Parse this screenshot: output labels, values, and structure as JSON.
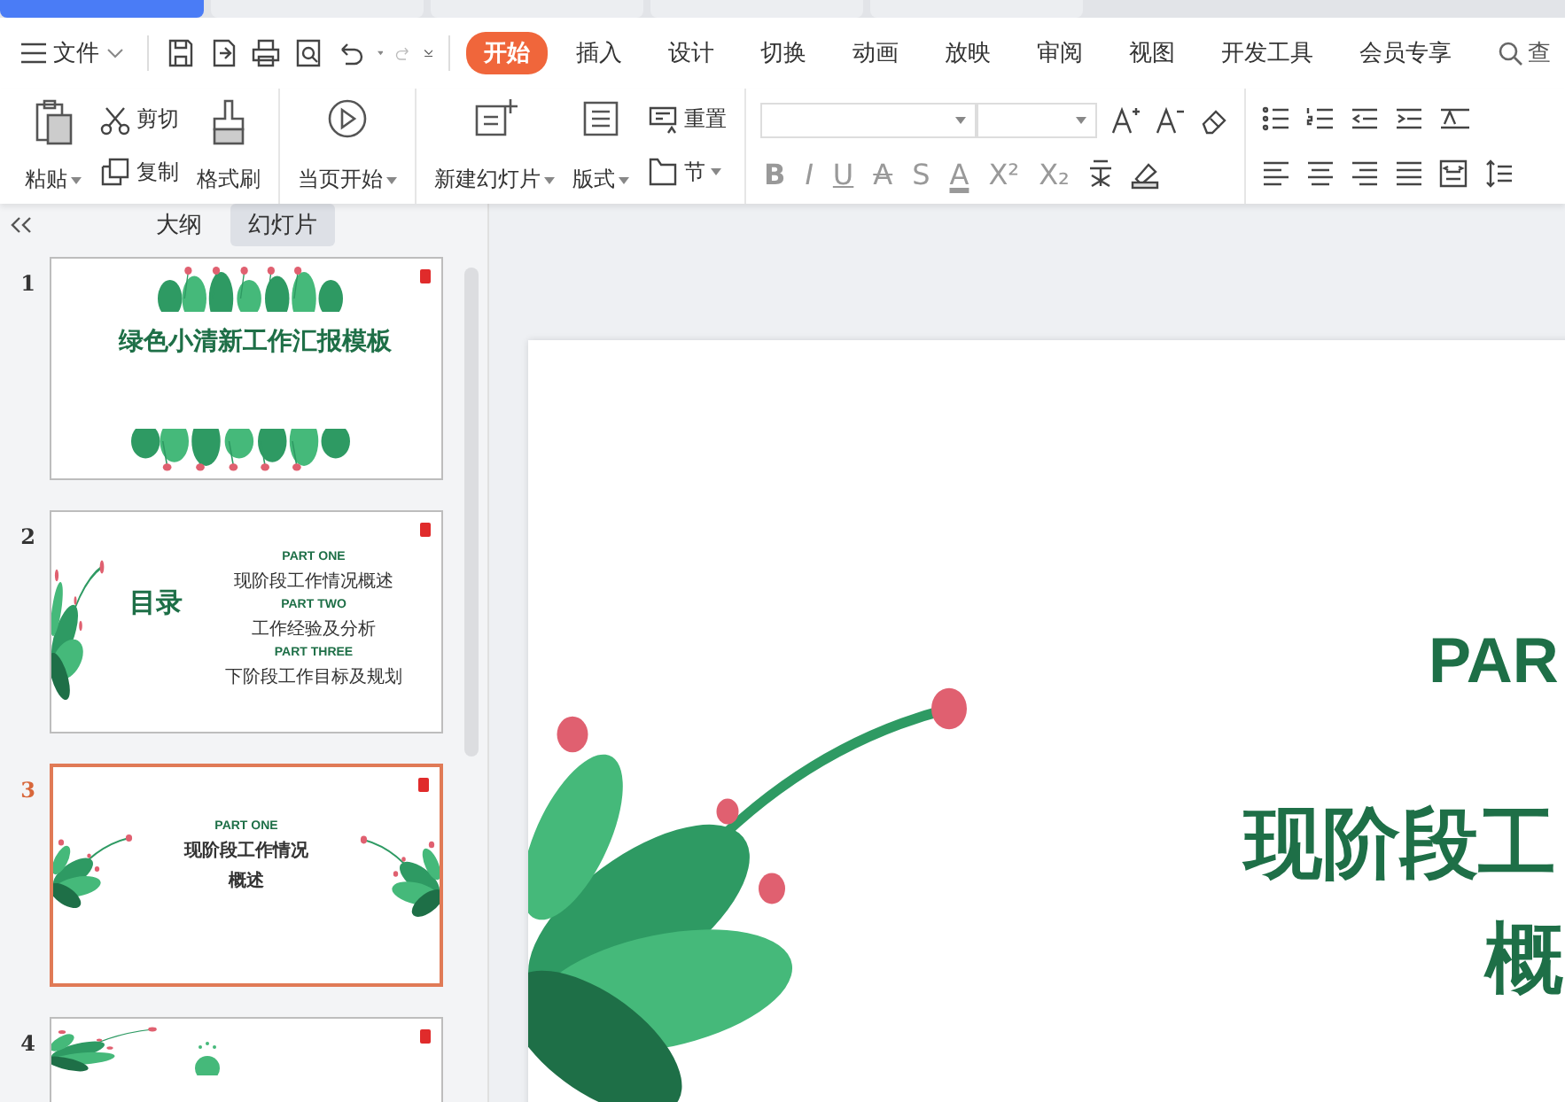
{
  "browser_tabs": [
    {
      "selected": true
    },
    {
      "selected": false
    },
    {
      "selected": false
    },
    {
      "selected": false
    },
    {
      "selected": false
    }
  ],
  "menu": {
    "file": "文件"
  },
  "ribbon_tabs": [
    {
      "label": "开始",
      "selected": true
    },
    {
      "label": "插入",
      "selected": false
    },
    {
      "label": "设计",
      "selected": false
    },
    {
      "label": "切换",
      "selected": false
    },
    {
      "label": "动画",
      "selected": false
    },
    {
      "label": "放映",
      "selected": false
    },
    {
      "label": "审阅",
      "selected": false
    },
    {
      "label": "视图",
      "selected": false
    },
    {
      "label": "开发工具",
      "selected": false
    },
    {
      "label": "会员专享",
      "selected": false
    }
  ],
  "search": {
    "label": "查"
  },
  "ribbon": {
    "paste": "粘贴",
    "cut": "剪切",
    "copy": "复制",
    "format_painter": "格式刷",
    "play_from_current": "当页开始",
    "new_slide": "新建幻灯片",
    "layout": "版式",
    "reset": "重置",
    "section": "节",
    "format_tools": [
      {
        "glyph": "B",
        "kind": "bold"
      },
      {
        "glyph": "I",
        "kind": "italic"
      },
      {
        "glyph": "U",
        "kind": "underline"
      },
      {
        "glyph": "A",
        "kind": "strike"
      },
      {
        "glyph": "S",
        "kind": "plain"
      },
      {
        "glyph": "A",
        "kind": "color"
      },
      {
        "glyph": "X²",
        "kind": "plain"
      },
      {
        "glyph": "X₂",
        "kind": "plain"
      }
    ]
  },
  "panel": {
    "tabs": [
      {
        "label": "大纲",
        "selected": false
      },
      {
        "label": "幻灯片",
        "selected": true
      }
    ]
  },
  "thumbnails": [
    {
      "number": "1",
      "selected": false,
      "kind": "title",
      "title": "绿色小清新工作汇报模板"
    },
    {
      "number": "2",
      "selected": false,
      "kind": "contents",
      "title": "目录",
      "items": [
        {
          "heading": "PART ONE",
          "caption": "现阶段工作情况概述"
        },
        {
          "heading": "PART TWO",
          "caption": "工作经验及分析"
        },
        {
          "heading": "PART THREE",
          "caption": "下阶段工作目标及规划"
        }
      ]
    },
    {
      "number": "3",
      "selected": true,
      "kind": "section",
      "heading": "PART ONE",
      "title": "现阶段工作情况",
      "subtitle": "概述"
    },
    {
      "number": "4",
      "selected": false,
      "kind": "text"
    }
  ],
  "slide": {
    "heading": "PAR",
    "title": "现阶段工",
    "subtitle": "概"
  }
}
